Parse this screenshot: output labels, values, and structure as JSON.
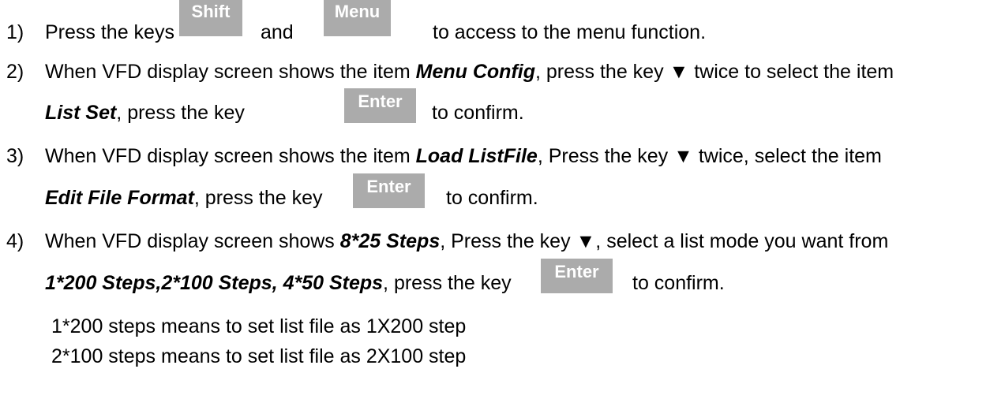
{
  "keys": {
    "shift": "Shift",
    "menu": "Menu",
    "enter": "Enter",
    "down_arrow": "▼"
  },
  "steps": [
    {
      "num": "1)",
      "a": "Press the keys",
      "b": "and",
      "c": "to access to the menu function."
    },
    {
      "num": "2)",
      "a": "When VFD display screen shows the item",
      "b_bold": "Menu Config",
      "c": ", press the key",
      "d": "twice to select the item",
      "e_bold": "List Set",
      "f": ", press the key",
      "g": "to confirm."
    },
    {
      "num": "3)",
      "a": "When VFD display screen shows the item",
      "b_bold": "Load ListFile",
      "c": ", Press the key",
      "d": "twice, select the item",
      "e_bold": "Edit File Format",
      "f": ", press the key",
      "g": "to confirm."
    },
    {
      "num": "4)",
      "a": "When VFD display screen shows",
      "b_bold": "8*25 Steps",
      "c": ", Press the key",
      "d": ", select a list mode you want from",
      "e_bold": "1*200 Steps,2*100 Steps, 4*50 Steps",
      "f": ", press the key",
      "g": "to confirm."
    }
  ],
  "notes": [
    "1*200 steps means to set list file as 1X200 step",
    "2*100 steps means to set list file as 2X100 step"
  ]
}
